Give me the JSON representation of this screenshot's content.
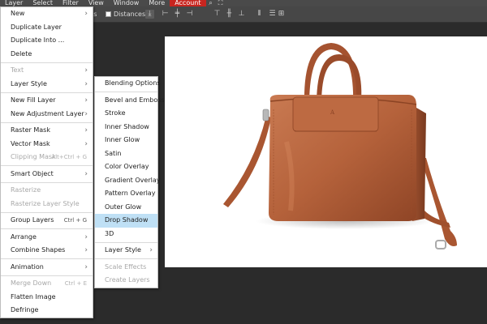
{
  "menubar": {
    "items": [
      "Layer",
      "Select",
      "Filter",
      "View",
      "Window",
      "More",
      "Account"
    ],
    "icons": [
      "search-icon",
      "fullscreen-icon"
    ]
  },
  "optbar": {
    "left_text": "ls",
    "distances_label": "Distances",
    "distances_checked": false
  },
  "layer_menu": {
    "items": [
      {
        "label": "New",
        "arrow": true
      },
      {
        "label": "Duplicate Layer"
      },
      {
        "label": "Duplicate Into ..."
      },
      {
        "label": "Delete"
      },
      {
        "sep": true
      },
      {
        "label": "Text",
        "arrow": true,
        "disabled": true
      },
      {
        "label": "Layer Style",
        "arrow": true
      },
      {
        "sep": true
      },
      {
        "label": "New Fill Layer",
        "arrow": true
      },
      {
        "label": "New Adjustment Layer",
        "arrow": true
      },
      {
        "sep": true
      },
      {
        "label": "Raster Mask",
        "arrow": true
      },
      {
        "label": "Vector Mask",
        "arrow": true
      },
      {
        "label": "Clipping Mask",
        "shortcut": "Alt+Ctrl + G",
        "disabled": true
      },
      {
        "sep": true
      },
      {
        "label": "Smart Object",
        "arrow": true
      },
      {
        "sep": true
      },
      {
        "label": "Rasterize",
        "disabled": true
      },
      {
        "label": "Rasterize Layer Style",
        "disabled": true
      },
      {
        "sep": true
      },
      {
        "label": "Group Layers",
        "shortcut": "Ctrl + G"
      },
      {
        "sep": true
      },
      {
        "label": "Arrange",
        "arrow": true
      },
      {
        "label": "Combine Shapes",
        "arrow": true
      },
      {
        "sep": true
      },
      {
        "label": "Animation",
        "arrow": true
      },
      {
        "sep": true
      },
      {
        "label": "Merge Down",
        "shortcut": "Ctrl + E",
        "disabled": true
      },
      {
        "label": "Flatten Image"
      },
      {
        "label": "Defringe"
      }
    ]
  },
  "style_menu": {
    "items": [
      {
        "label": "Blending Options"
      },
      {
        "sep": true
      },
      {
        "label": "Bevel and Emboss"
      },
      {
        "label": "Stroke"
      },
      {
        "label": "Inner Shadow"
      },
      {
        "label": "Inner Glow"
      },
      {
        "label": "Satin"
      },
      {
        "label": "Color Overlay"
      },
      {
        "label": "Gradient Overlay"
      },
      {
        "label": "Pattern Overlay"
      },
      {
        "label": "Outer Glow"
      },
      {
        "label": "Drop Shadow",
        "highlight": true
      },
      {
        "label": "3D"
      },
      {
        "sep": true
      },
      {
        "label": "Layer Style",
        "arrow": true
      },
      {
        "sep": true
      },
      {
        "label": "Scale Effects",
        "disabled": true
      },
      {
        "label": "Create Layers",
        "disabled": true
      }
    ]
  },
  "colors": {
    "menubar_bg": "#4a4a4a",
    "account_bg": "#c8251f",
    "highlight": "#bfe0f5",
    "bag": "#b5623b"
  }
}
